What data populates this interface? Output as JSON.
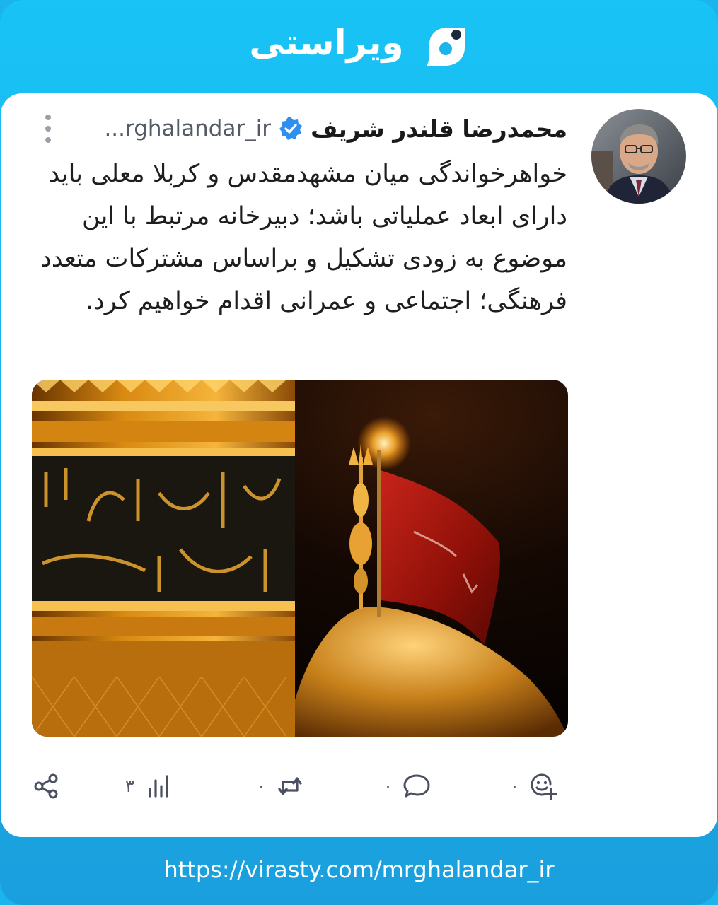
{
  "app": {
    "brand_name": "ویراستی",
    "accent_color": "#17aee8",
    "logo_icon": "virasty-logo-icon"
  },
  "post": {
    "author_name": "محمدرضا قلندر شریف",
    "verified_icon": "verified-badge-icon",
    "username": "...rghalandar_ir",
    "more_icon": "more-vertical-icon",
    "avatar_icon": "avatar",
    "text": "خواهرخواندگی میان مشهدمقدس و کربلا معلی باید دارای ابعاد عملیاتی باشد؛ دبیرخانه مرتبط با این موضوع به زودی تشکیل و براساس مشترکات متعدد فرهنگی؛ اجتماعی و عمرانی اقدام خواهیم کرد.",
    "image_description_icon": "shrine-dome-photo"
  },
  "actions": {
    "share": {
      "icon": "share-icon",
      "count": ""
    },
    "views": {
      "icon": "bar-chart-icon",
      "count": "۳"
    },
    "repost": {
      "icon": "repost-icon",
      "count": "۰"
    },
    "comment": {
      "icon": "comment-icon",
      "count": "۰"
    },
    "react": {
      "icon": "add-reaction-icon",
      "count": "۰"
    }
  },
  "footer": {
    "url": "https://virasty.com/mrghalandar_ir"
  }
}
